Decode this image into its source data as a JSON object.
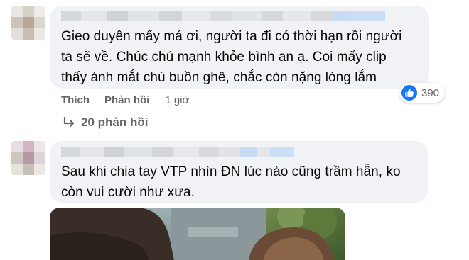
{
  "comments": [
    {
      "text_lines": [
        "Gieo duyên mấy má ơi, người ta đi có thời hạn rồi người",
        "ta sẽ về. Chúc chú mạnh khỏe bình an ạ. Coi mấy clip",
        "thấy ánh mắt chú buồn ghê, chắc còn nặng lòng lắm"
      ],
      "actions": {
        "like_label": "Thích",
        "reply_label": "Phản hồi",
        "time": "1 giờ"
      },
      "reaction": {
        "icon": "thumbs-up-icon",
        "count": "390",
        "color": "#1877f2"
      },
      "replies_label": "20 phản hồi"
    },
    {
      "text_lines": [
        "Sau khi chia tay VTP nhìn ĐN lúc nào cũng trầm hẫn, ko",
        "còn vui cười như xưa."
      ],
      "attachment": "photo"
    }
  ],
  "colors": {
    "bubble": "#f0f2f5",
    "secondary_text": "#65676b",
    "primary_text": "#050505",
    "accent": "#1877f2"
  }
}
